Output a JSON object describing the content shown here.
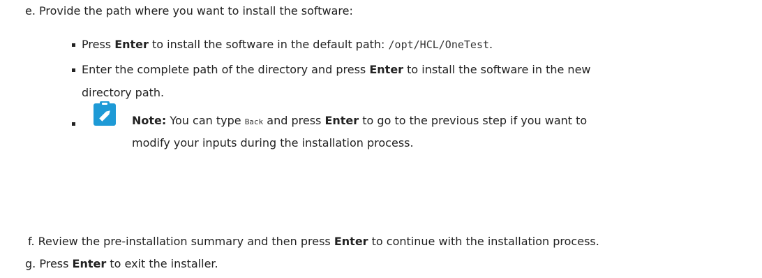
{
  "steps": {
    "e": {
      "marker": "e.",
      "text": "Provide the path where you want to install the software:",
      "bullets": {
        "b1": {
          "pre": "Press ",
          "bold": "Enter",
          "mid": " to install the software in the default path: ",
          "code": "/opt/HCL/OneTest",
          "post": "."
        },
        "b2": {
          "pre": "Enter the complete path of the directory and press ",
          "bold": "Enter",
          "post": " to install the software in the new",
          "line2": "directory path."
        }
      },
      "note": {
        "icon": "pencil-note-icon",
        "label": "Note:",
        "pre": " You can type ",
        "code": "Back",
        "mid": " and press ",
        "bold": "Enter",
        "post": " to go to the previous step if you want to",
        "line2": "modify your inputs during the installation process."
      }
    },
    "f": {
      "marker": "f.",
      "pre": "Review the pre-installation summary and then press ",
      "bold": "Enter",
      "post": " to continue with the installation process."
    },
    "g": {
      "marker": "g.",
      "pre": "Press ",
      "bold": "Enter",
      "post": " to exit the installer."
    }
  },
  "colors": {
    "text": "#222222",
    "note_icon": "#1e9ad6"
  }
}
